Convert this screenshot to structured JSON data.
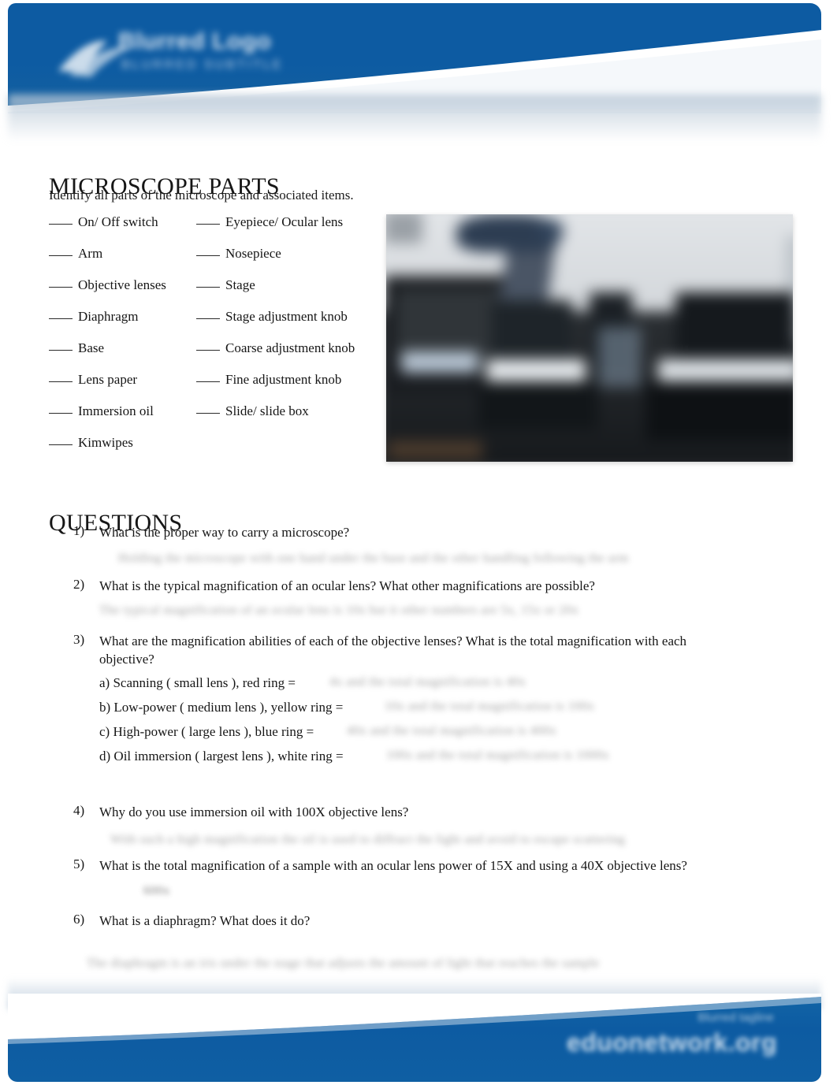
{
  "page": {
    "background_color": "#ffffff",
    "brand_blue": "#0d5ba2"
  },
  "header": {
    "logo_name": "organization-logo",
    "logo_text": "Blurred Logo",
    "logo_subtext": "BLURRED SUBTITLE"
  },
  "parts_section": {
    "title": "MICROSCOPE PARTS",
    "subtitle": "Identify all parts of the microscope and associated items.",
    "blank_marker": "___",
    "left_column": [
      "On/ Off switch",
      "Arm",
      "Objective lenses",
      "Diaphragm",
      "Base",
      "Lens paper",
      "Immersion oil",
      "Kimwipes"
    ],
    "right_column": [
      "Eyepiece/ Ocular lens",
      "Nosepiece",
      "Stage",
      "Stage adjustment knob",
      "Coarse adjustment knob",
      "Fine adjustment knob",
      "Slide/ slide box"
    ],
    "photo_caption": "blurred photograph of a compound microscope on a lab bench"
  },
  "questions_section": {
    "title": "QUESTIONS",
    "items": [
      {
        "number": "1)",
        "text": "What is the proper way to carry a microscope?",
        "answer": "Holding the microscope with one hand under the base and the other handling following the arm"
      },
      {
        "number": "2)",
        "text": "What is the typical magnification of an ocular lens? What other magnifications are possible?",
        "answer": "The typical magnification of an ocular lens is 10x but it other numbers are 5x, 15x or 20x"
      },
      {
        "number": "3)",
        "text": "What are the magnification abilities of each of the objective lenses? What is the total magnification with each objective?",
        "sub_items": [
          {
            "label": "a) Scanning ( small lens ), red ring =",
            "answer": "4x and the total magnification is 40x"
          },
          {
            "label": "b) Low-power ( medium lens ), yellow ring =",
            "answer": "10x and the total magnification is 100x"
          },
          {
            "label": "c) High-power ( large lens ), blue ring =",
            "answer": "40x and the total magnification is 400x"
          },
          {
            "label": "d) Oil immersion ( largest lens ), white ring =",
            "answer": "100x and the total magnification is 1000x"
          }
        ]
      },
      {
        "number": "4)",
        "text": "Why do you use immersion oil with 100X objective lens?",
        "answer": "With such a high magnification the oil is used to diffract the light and avoid to escape scattering"
      },
      {
        "number": "5)",
        "text": "What is the total magnification of a sample with an ocular lens power of 15X and using a 40X objective lens?",
        "answer": "600x"
      },
      {
        "number": "6)",
        "text": "What is a diaphragm? What does it do?",
        "answer": "The diaphragm is an iris under the stage that adjusts the amount of light that reaches the sample"
      }
    ]
  },
  "footer": {
    "tagline": "Blurred tagline",
    "url": "eduonetwork.org"
  }
}
